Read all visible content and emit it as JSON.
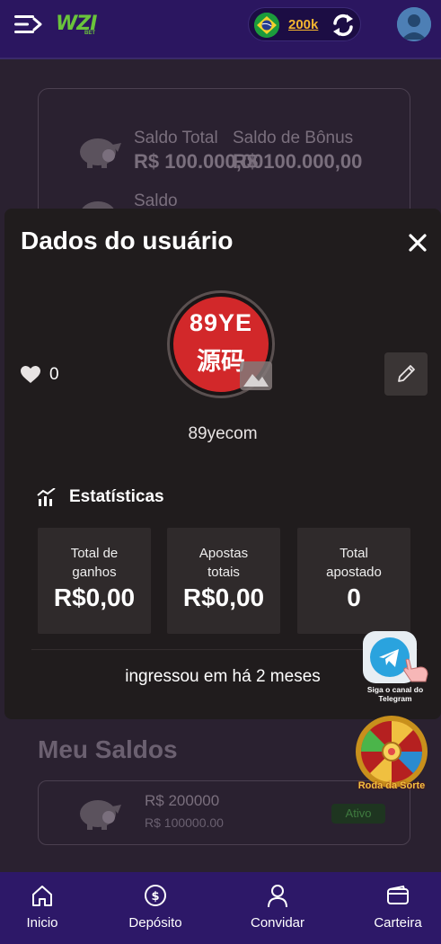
{
  "header": {
    "logo_text": "WZI",
    "logo_sub": "BET",
    "balance": "200k",
    "icons": [
      "menu-icon",
      "brazil-flag-icon",
      "refresh-icon",
      "avatar-icon"
    ]
  },
  "background_page": {
    "saldo_total_label": "Saldo Total",
    "saldo_total_value": "R$ 100.000,00",
    "saldo_bonus_label": "Saldo de Bônus",
    "saldo_bonus_value": "R$ 100.000,00",
    "saldo_label": "Saldo",
    "meu_saldos_title": "Meu Saldos",
    "row": {
      "amount": "R$ 200000",
      "sub_amount": "R$ 100000.00",
      "status": "Ativo"
    }
  },
  "modal": {
    "title": "Dados do usuário",
    "likes": "0",
    "avatar_text_top": "89YE",
    "avatar_text_bottom": "源码",
    "username": "89yecom",
    "stats_title": "Estatísticas",
    "stats": [
      {
        "label": "Total de ganhos",
        "value": "R$0,00"
      },
      {
        "label": "Apostas totais",
        "value": "R$0,00"
      },
      {
        "label": "Total apostado",
        "value": "0"
      }
    ],
    "joined": "ingressou em há 2 meses"
  },
  "widgets": {
    "telegram_label": "Siga o canal do Telegram",
    "wheel_label": "Roda da Sorte"
  },
  "bottom_nav": [
    {
      "label": "Inicio",
      "icon": "home-icon"
    },
    {
      "label": "Depósito",
      "icon": "deposit-icon"
    },
    {
      "label": "Convidar",
      "icon": "user-icon"
    },
    {
      "label": "Carteira",
      "icon": "wallet-icon"
    }
  ],
  "colors": {
    "header_bg": "#2b1660",
    "modal_bg": "#201c1d",
    "accent_gold": "#f3b530",
    "logo_green": "#6ac43b",
    "nav_bg": "#2d1868"
  }
}
